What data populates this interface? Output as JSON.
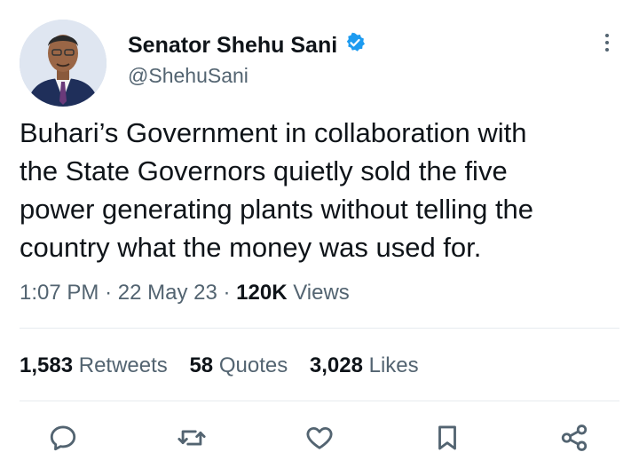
{
  "tweet": {
    "author": {
      "name": "Senator Shehu Sani",
      "handle": "@ShehuSani",
      "verified": true
    },
    "text_lines": [
      "Buhari’s Government in collaboration with",
      "the State Governors quietly sold the five",
      "power generating plants without telling the",
      "country what the money was used for."
    ],
    "time": "1:07 PM",
    "separator": "·",
    "date": "22 May 23",
    "views_count": "120K",
    "views_label": "Views",
    "retweets_count": "1,583",
    "retweets_label": "Retweets",
    "quotes_count": "58",
    "quotes_label": "Quotes",
    "likes_count": "3,028",
    "likes_label": "Likes"
  },
  "icons": {
    "verified": "verified-badge-icon",
    "more": "more-vertical-icon",
    "reply": "reply-icon",
    "retweet": "retweet-icon",
    "like": "heart-icon",
    "bookmark": "bookmark-icon",
    "share": "share-icon"
  },
  "colors": {
    "text": "#0f1419",
    "secondary": "#536471",
    "verified": "#1d9bf0",
    "divider": "#e6ebef"
  }
}
